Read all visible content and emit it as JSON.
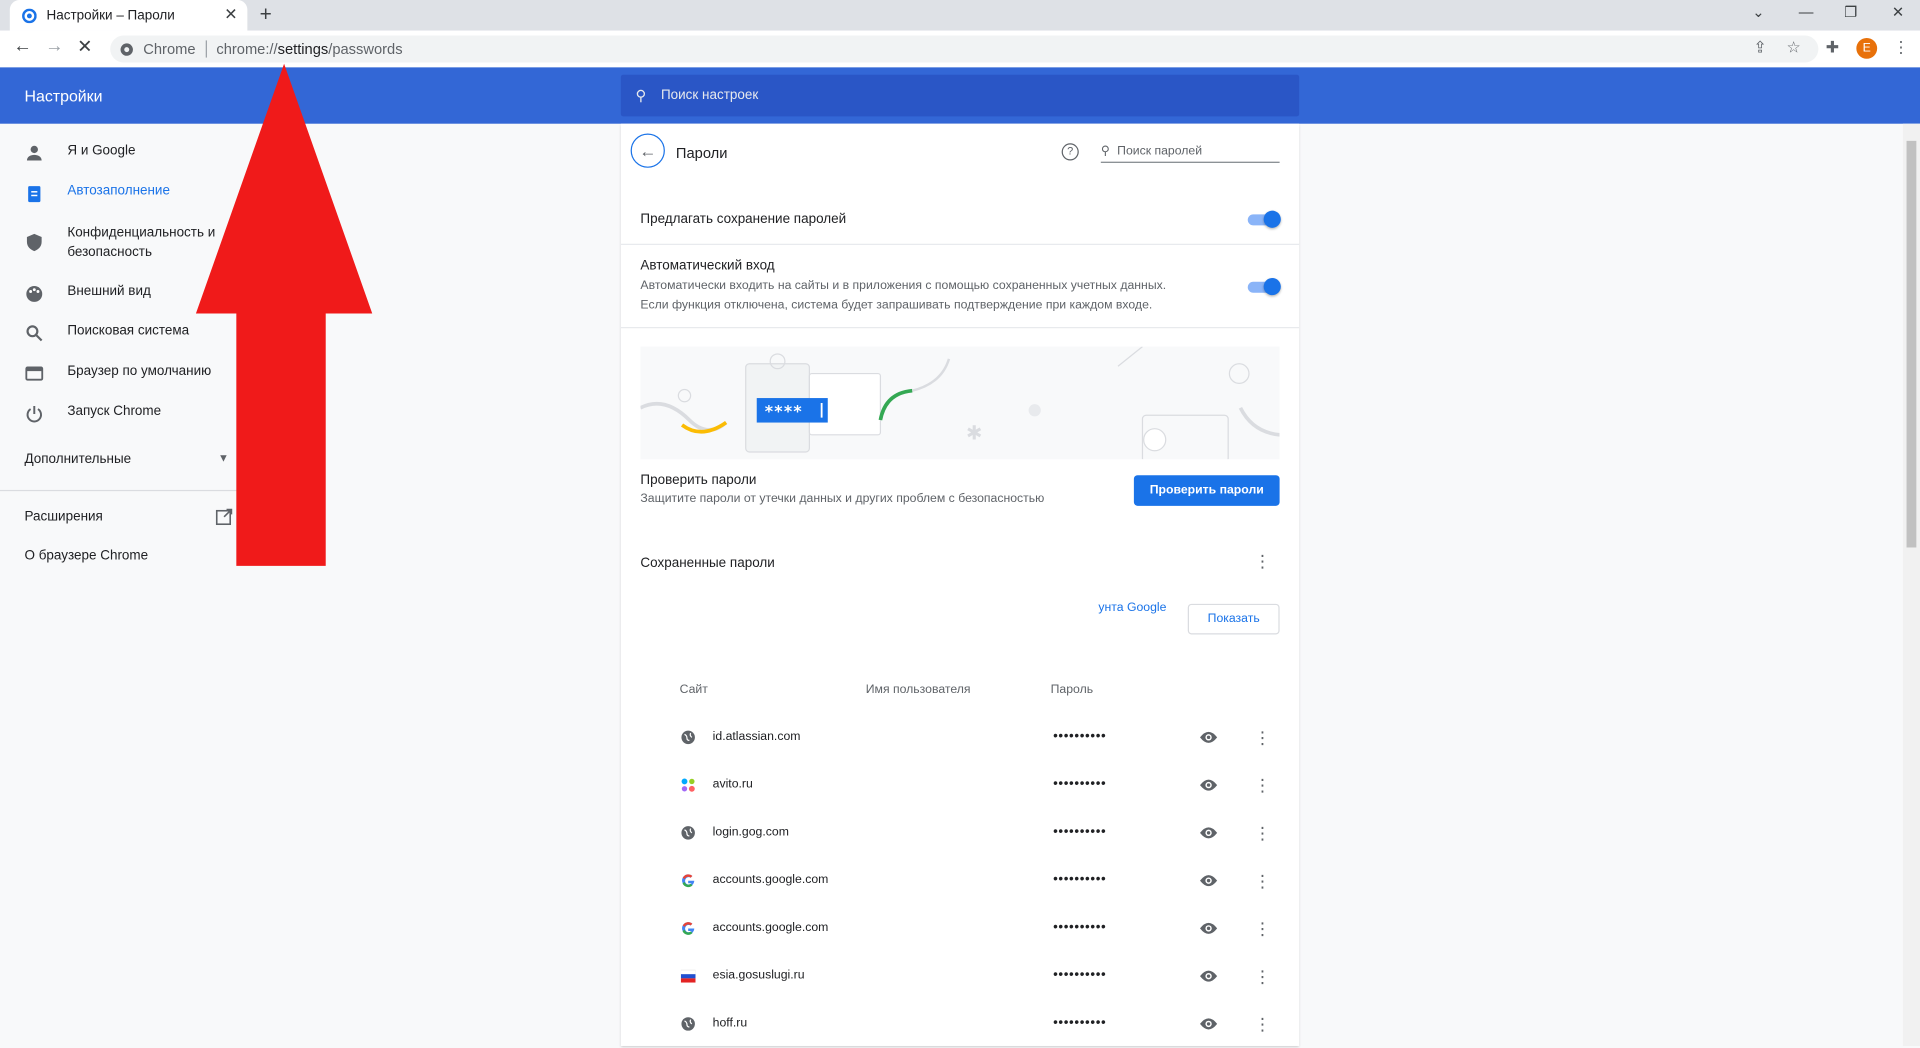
{
  "browser": {
    "tab_title": "Настройки – Пароли",
    "omnibox_site": "Chrome",
    "url_prefix": "chrome://",
    "url_host": "settings",
    "url_path": "/passwords",
    "avatar_letter": "E"
  },
  "header": {
    "title": "Настройки",
    "search_placeholder": "Поиск настроек"
  },
  "sidebar": {
    "items": [
      {
        "label": "Я и Google",
        "icon": "person-icon"
      },
      {
        "label": "Автозаполнение",
        "icon": "clipboard-icon"
      },
      {
        "label": "Конфиденциальность и безопасность",
        "icon": "shield-icon"
      },
      {
        "label": "Внешний вид",
        "icon": "palette-icon"
      },
      {
        "label": "Поисковая система",
        "icon": "search-icon"
      },
      {
        "label": "Браузер по умолчанию",
        "icon": "browser-icon"
      },
      {
        "label": "Запуск Chrome",
        "icon": "power-icon"
      }
    ],
    "advanced": "Дополнительные",
    "extensions": "Расширения",
    "about": "О браузере Chrome"
  },
  "passwords": {
    "title": "Пароли",
    "search_placeholder": "Поиск паролей",
    "offer_save_label": "Предлагать сохранение паролей",
    "offer_save_enabled": true,
    "auto_signin_label": "Автоматический вход",
    "auto_signin_desc_1": "Автоматически входить на сайты и в приложения с помощью сохраненных учетных данных.",
    "auto_signin_desc_2": "Если функция отключена, система будет запрашивать подтверждение при каждом входе.",
    "auto_signin_enabled": true,
    "illustration_text": "****",
    "check_title": "Проверить пароли",
    "check_desc": "Защитите пароли от утечки данных и других проблем с безопасностью",
    "check_button": "Проверить пароли",
    "saved_title": "Сохраненные пароли",
    "account_link_fragment": "унта Google",
    "show_button": "Показать",
    "columns": {
      "site": "Сайт",
      "username": "Имя пользователя",
      "password": "Пароль"
    },
    "rows": [
      {
        "site": "id.atlassian.com",
        "password": "••••••••••",
        "favicon": "globe-icon"
      },
      {
        "site": "avito.ru",
        "password": "••••••••••",
        "favicon": "avito-icon"
      },
      {
        "site": "login.gog.com",
        "password": "••••••••••",
        "favicon": "globe-icon"
      },
      {
        "site": "accounts.google.com",
        "password": "••••••••••",
        "favicon": "google-icon"
      },
      {
        "site": "accounts.google.com",
        "password": "••••••••••",
        "favicon": "google-icon"
      },
      {
        "site": "esia.gosuslugi.ru",
        "password": "••••••••••",
        "favicon": "russian-flag-icon"
      },
      {
        "site": "hoff.ru",
        "password": "••••••••••",
        "favicon": "globe-icon"
      }
    ]
  },
  "colors": {
    "header_blue": "#3367d6",
    "accent": "#1a73e8",
    "annotation_arrow": "#f01a1a"
  }
}
